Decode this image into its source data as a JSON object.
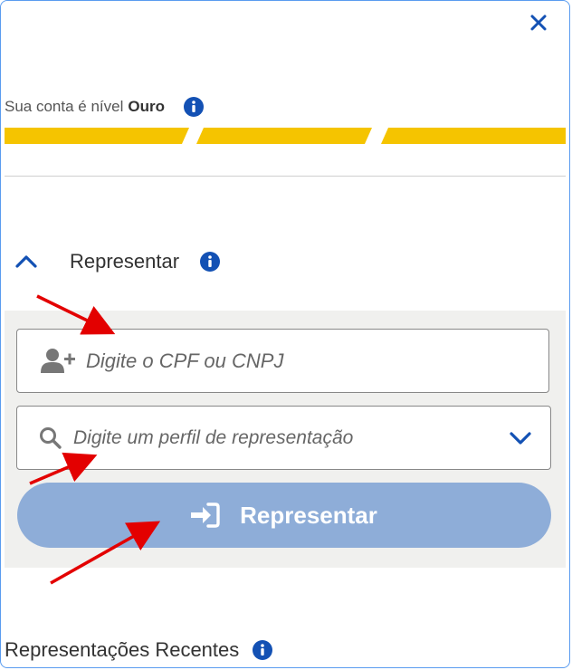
{
  "header": {
    "close_icon": "close-icon"
  },
  "account_level": {
    "prefix": "Sua conta é nível",
    "level": "Ouro",
    "info_icon": "info-icon",
    "bar_segments_filled": 3,
    "bar_segments_total": 3,
    "bar_color": "#f5c400"
  },
  "represent_section": {
    "title": "Representar",
    "expanded": true,
    "chevron_icon": "chevron-up-icon",
    "info_icon": "info-icon",
    "cpf_field": {
      "placeholder": "Digite o CPF ou CNPJ",
      "icon": "add-user-icon"
    },
    "profile_field": {
      "placeholder": "Digite um perfil de representação",
      "icon": "search-icon",
      "dropdown_icon": "chevron-down-icon"
    },
    "submit_button": {
      "label": "Representar",
      "icon": "sign-in-icon",
      "color": "#8eadd8"
    }
  },
  "recent_section": {
    "title": "Representações Recentes",
    "info_icon": "info-icon"
  },
  "colors": {
    "accent": "#1351b4",
    "annotation_arrow": "#e30000",
    "panel_bg": "#f0f0ee"
  }
}
